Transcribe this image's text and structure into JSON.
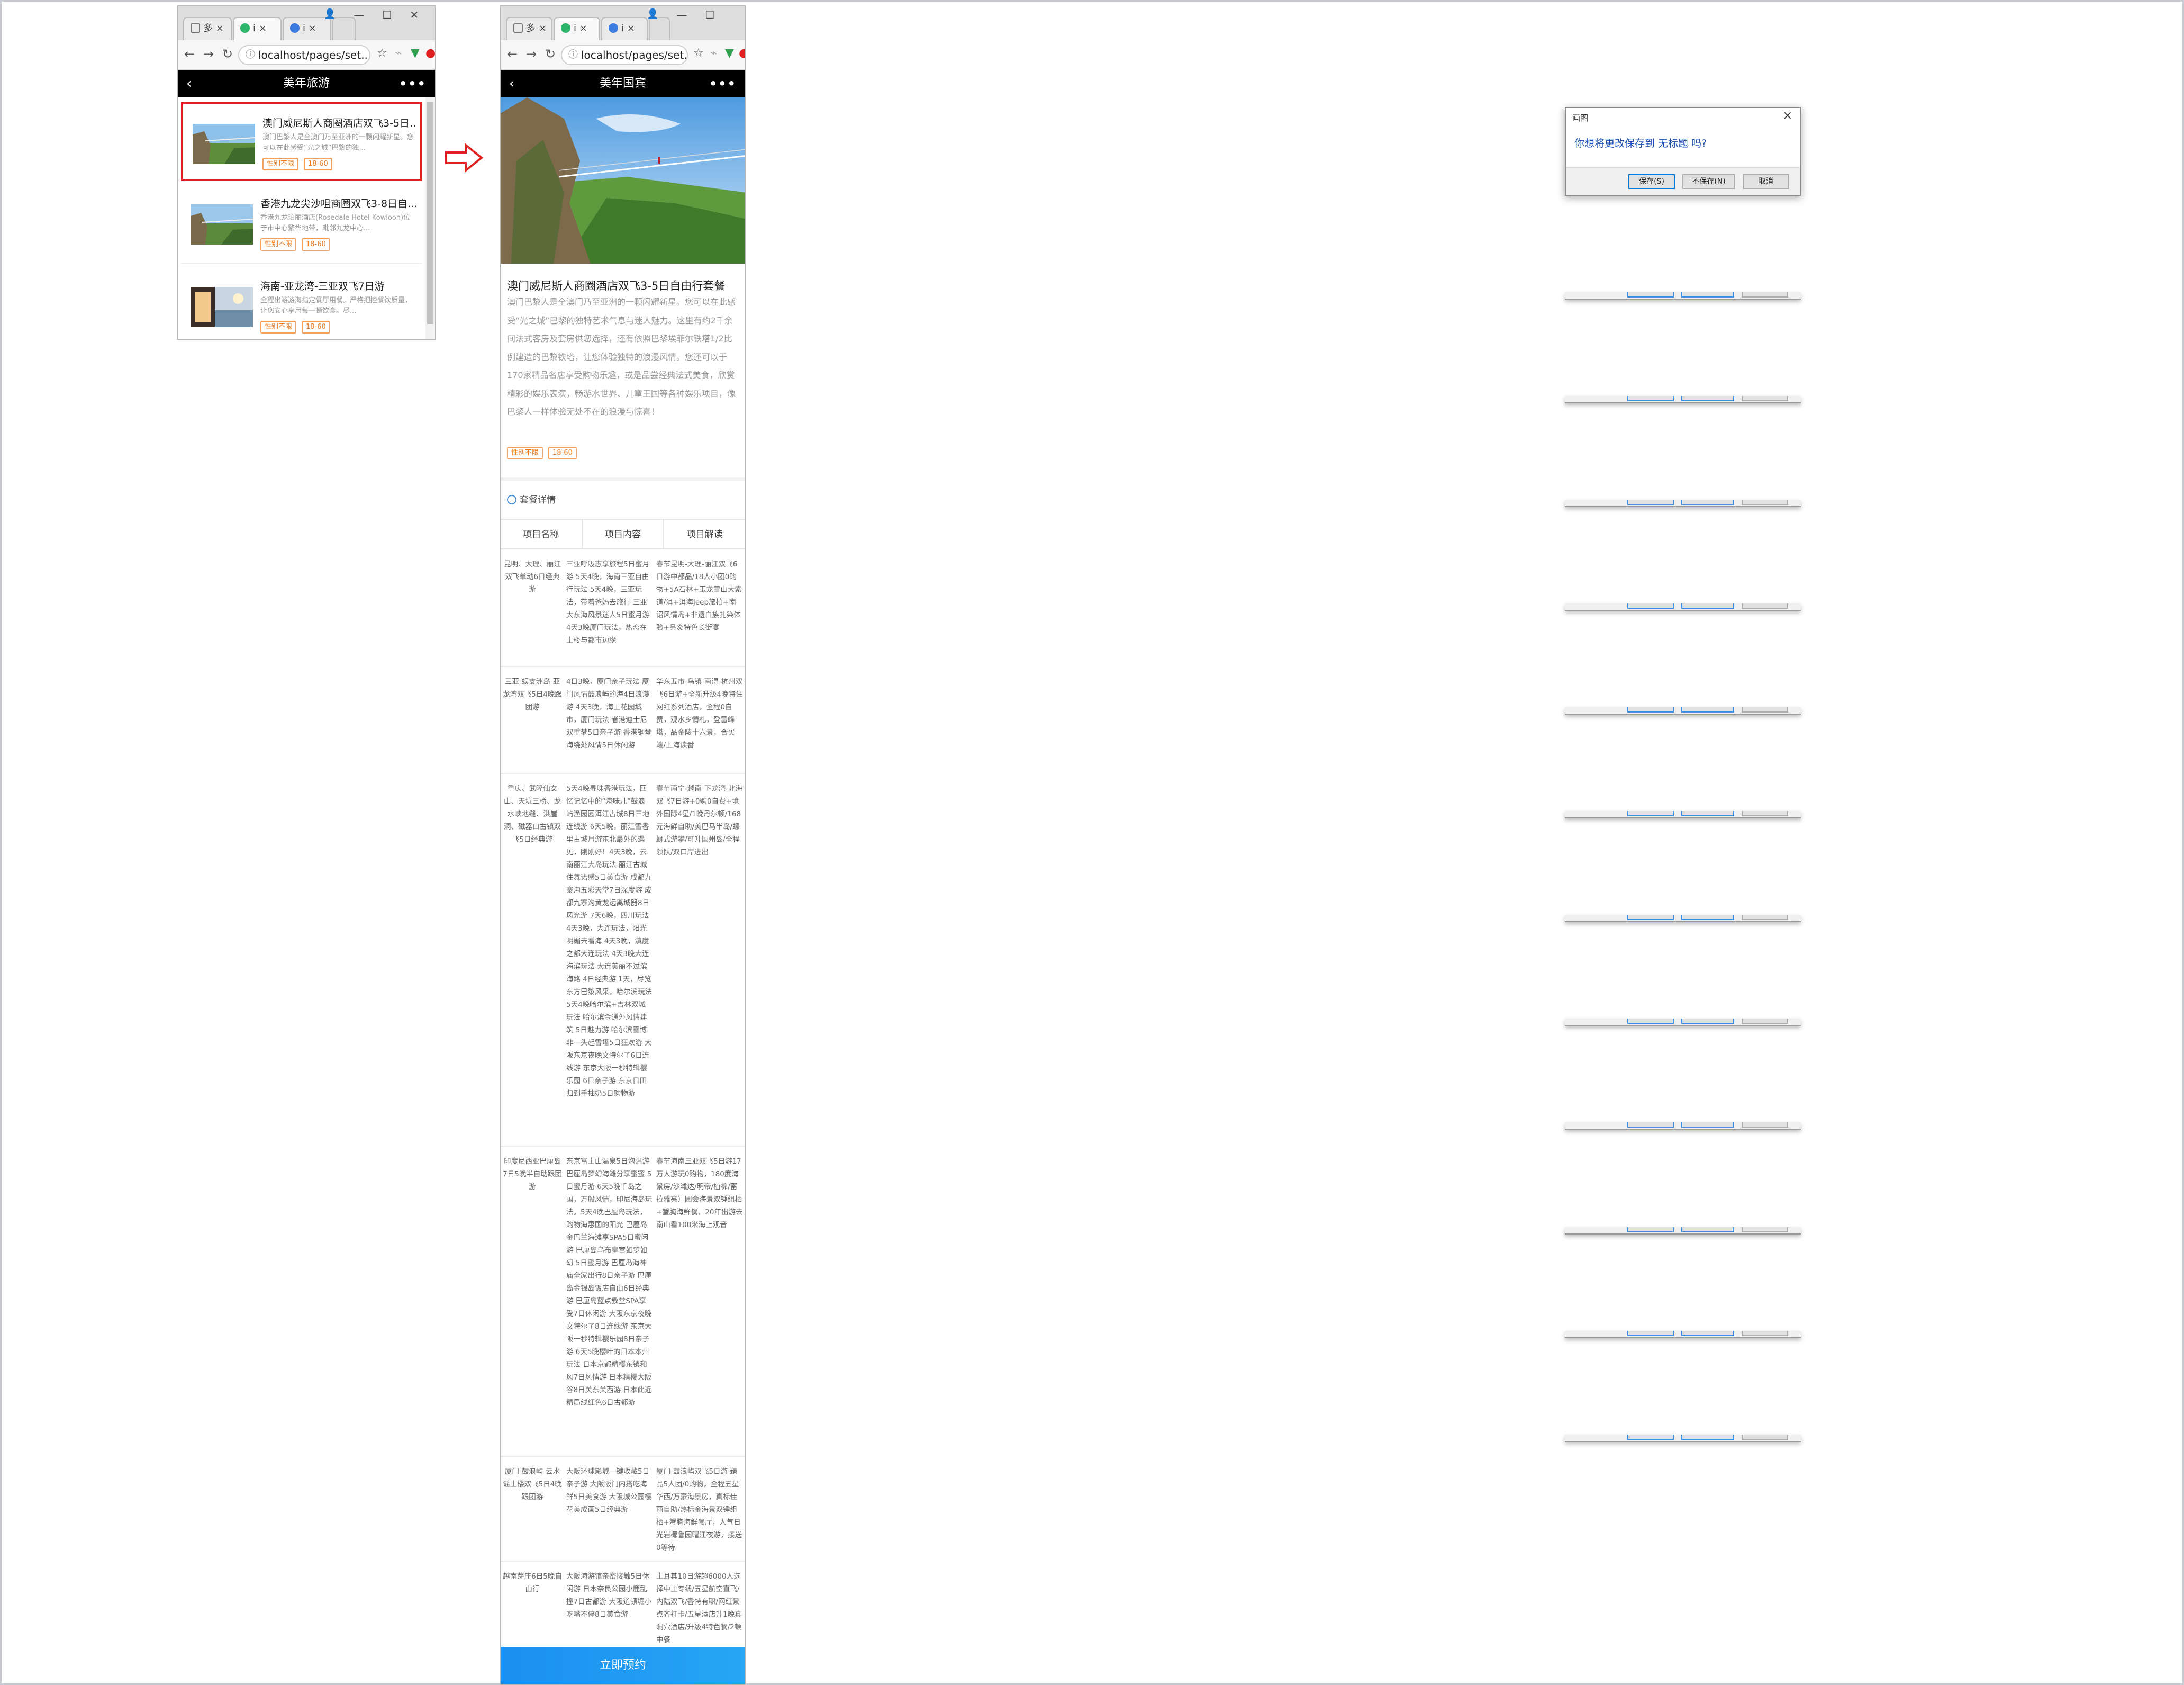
{
  "left_browser": {
    "tabs": [
      {
        "label": "多 ×"
      },
      {
        "label": "i ×"
      },
      {
        "label": "i ×"
      }
    ],
    "address": "localhost/pages/set...",
    "header_title": "美年旅游",
    "items": [
      {
        "title": "澳门威尼斯人商圈酒店双飞3-5日...",
        "desc": "澳门巴黎人是全澳门乃至亚洲的一颗闪耀新星。您可以在此感受“光之城”巴黎的独...",
        "tags": [
          "性别不限",
          "18-60"
        ]
      },
      {
        "title": "香港九龙尖沙咀商圈双飞3-8日自...",
        "desc": "香港九龙珀丽酒店(Rosedale Hotel Kowloon)位于市中心繁华地带，毗邻九龙中心...",
        "tags": [
          "性别不限",
          "18-60"
        ]
      },
      {
        "title": "海南-亚龙湾-三亚双飞7日游",
        "desc": "全程出游游海指定餐厅用餐。严格把控餐饮质量，让您安心享用每一顿饮食。尽...",
        "tags": [
          "性别不限",
          "18-60"
        ]
      }
    ]
  },
  "right_browser": {
    "tabs": [
      {
        "label": "多 ×"
      },
      {
        "label": "i ×"
      },
      {
        "label": "i ×"
      }
    ],
    "address": "localhost/pages/set...",
    "header_title": "美年国宾",
    "detail_title": "澳门威尼斯人商圈酒店双飞3-5日自由行套餐",
    "detail_desc": "澳门巴黎人是全澳门乃至亚洲的一颗闪耀新星。您可以在此感受“光之城”巴黎的独特艺术气息与迷人魅力。这里有约2千余间法式客房及套房供您选择，还有依照巴黎埃菲尔铁塔1/2比例建造的巴黎铁塔，让您体验独特的浪漫风情。您还可以于170家精品名店享受购物乐趣，或是品尝经典法式美食，欣赏精彩的娱乐表演，畅游水世界、儿童王国等各种娱乐项目，像巴黎人一样体验无处不在的浪漫与惊喜！",
    "detail_tags": [
      "性别不限",
      "18-60"
    ],
    "package_heading": "套餐详情",
    "table_headers": [
      "项目名称",
      "项目内容",
      "项目解读"
    ],
    "rows": [
      {
        "name": "昆明、大理、丽江双飞单动6日经典游",
        "content": "三亚呼吸志享旅程5日蜜月游 5天4晚，海南三亚自由行玩法 5天4晚，三亚玩法，带着爸妈去旅行 三亚大东海风景迷人5日蜜月游 4天3晚厦门玩法，热恋在土楼与都市边缘",
        "note": "春节昆明-大理-丽江双飞6日游中都品/18人小团0购物+5A石林+玉龙雪山大索道/洱+洱海Jeep旅拍+南诏风情岛+非遗白族扎染体验+鼻炎特色长街宴"
      },
      {
        "name": "三亚-蜈支洲岛-亚龙湾双飞5日4晚跟团游",
        "content": "4日3晚，厦门亲子玩法 厦门风情鼓浪屿的海4日浪漫游 4天3晚，海上花园城市，厦门玩法 者港迪士尼双重梦5日亲子游 香港钢琴海绕处风情5日休闲游",
        "note": "华东五市-乌镇-南浔-杭州双飞6日游+全新升级4晚特住网红系列酒店，全程0自费，观水乡情札，登雷峰塔，品金陵十六景，合买端/上海读番"
      },
      {
        "name": "重庆、武隆仙女山、天坑三桥、龙水峡地缝、洪崖洞、磁器口古镇双飞5日经典游",
        "content": "5天4晚寻味香港玩法，回忆记忆中的“港味儿”鼓浪屿渔园园洱江古城8日三地连线游 6天5晚，丽江雪香里古城月游东北最外的遇见，刚刚好！4天3晚，云南丽江大岛玩法 丽江古城住舞诺感5日美食游 成都九寨沟五彩天堂7日深度游 成都九寨沟黄龙远离城器8日风光游 7天6晚，四川玩法 4天3晚，大连玩法，阳光明媚去看海 4天3晚，滇度之都大连玩法 4天3晚大连海滨玩法 大连美丽不过滨海路 4日经典游 1天，尽览东方巴黎风采，哈尔滨玩法 5天4晚哈尔滨+吉林双城玩法 哈尔滨金通外风情建筑 5日魅力游 哈尔滨雪博非一头起雪塔5日狂欢游 大阪东京夜晚文特尔了6日连线游 东京大阪一秒特辑樱乐园 6日亲子游 东京日田归到手抽奶5日购物游",
        "note": "春节南宁-越南-下龙湾-北海双飞7日游+0购0自费+境外国际4星/1晚丹尔顿/168元海鲜自助/美巴马半岛/螺蛳式游攀/可升国州岛/全程领队/双口岸进出"
      },
      {
        "name": "印度尼西亚巴厘岛7日5晚半自助跟团游",
        "content": "东京富士山温泉5日泡温游 巴厘岛梦幻海滩分享蜜蜜 5日蜜月游 6天5晚千岛之国，万般风情，印尼海岛玩法。5天4晚巴厘岛玩法，购物海惠国的阳光 巴厘岛金巴兰海滩享SPA5日蜜闲游 巴厘岛乌布皇宫如梦如幻 5日蜜月游 巴厘岛海神庙全家出行8日亲子游 巴厘岛金银岛饭店自由6日经典游 巴厘岛蓝点教堂SPA享受7日休闲游 大阪东京夜晚文特尔了8日连线游 东京大阪一秒特辑樱乐园8日亲子游 6天5晚樱叶的日本本州玩法 日本京都精樱东镇和风7日风情游 日本精樱大阪谷8日关东关西游 日本此近精局线红色6日古都游",
        "note": "春节海南三亚双飞5日游17万人游玩0购物，180度海景房/沙滩达/明帝/植棉/蓄拉雅亮）圃会海景双锤组栖+蟹胸海鲜餐，20年出游去南山看108米海上观音"
      },
      {
        "name": "厦门-鼓浪屿-云水谣土楼双飞5日4晚跟团游",
        "content": "大阪环球影城一键收藏5日亲子游 大阪阪门内搭吃海鲜5日美食游 大阪城公园樱花美成画5日经典游",
        "note": "厦门-鼓浪屿双飞5日游 臻品5人团/0购物，全程五星华西/万豪海景房，真标佳丽自助/热标金海景双锤组栖+蟹胸海鲜餐厅，人气日光岩椰鲁园曙江夜游，接送0等待"
      },
      {
        "name": "越南芽庄6日5晚自由行",
        "content": "大阪海游馆亲密接触5日休闲游 日本奈良公园小鹿乱撞7日古都游 大阪道顿堀小吃嘴不停8日美食游",
        "note": "土耳其10日游超6000人选择中土专线/五星航空直飞/内陆双飞/香特有职/网红景点齐打卡/五星酒店升1晚真洞穴酒店/升级4特色餐/2顿中餐"
      }
    ],
    "book_button": "立即预约"
  },
  "dialog": {
    "title": "画图",
    "message": "你想将更改保存到 无标题 吗?",
    "buttons": {
      "save": "保存(S)",
      "dont_save": "不保存(N)",
      "cancel": "取消"
    }
  },
  "colors": {
    "header_bg": "#000000",
    "tag_border": "#f5a05a",
    "tag_text": "#f07a1a",
    "selection_border": "#e02020",
    "arrow": "#e02020",
    "book_button": "#1a8ff0",
    "dialog_message": "#1a4fb4"
  },
  "icons": [
    "back-arrow-icon",
    "more-icon",
    "refresh-icon",
    "star-icon",
    "info-icon",
    "close-icon",
    "package-icon"
  ]
}
